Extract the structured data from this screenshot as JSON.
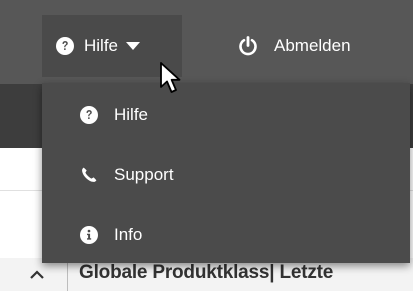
{
  "navbar": {
    "help_label": "Hilfe",
    "logout_label": "Abmelden"
  },
  "help_menu": {
    "items": [
      {
        "label": "Hilfe",
        "icon": "question-circle-icon"
      },
      {
        "label": "Support",
        "icon": "phone-icon"
      },
      {
        "label": "Info",
        "icon": "info-circle-icon"
      }
    ]
  },
  "table": {
    "column_header": "Globale Produktklass| Letzte"
  },
  "colors": {
    "navbar_bg": "#575757",
    "dropdown_bg": "#4b4b4b",
    "text": "#ffffff"
  }
}
